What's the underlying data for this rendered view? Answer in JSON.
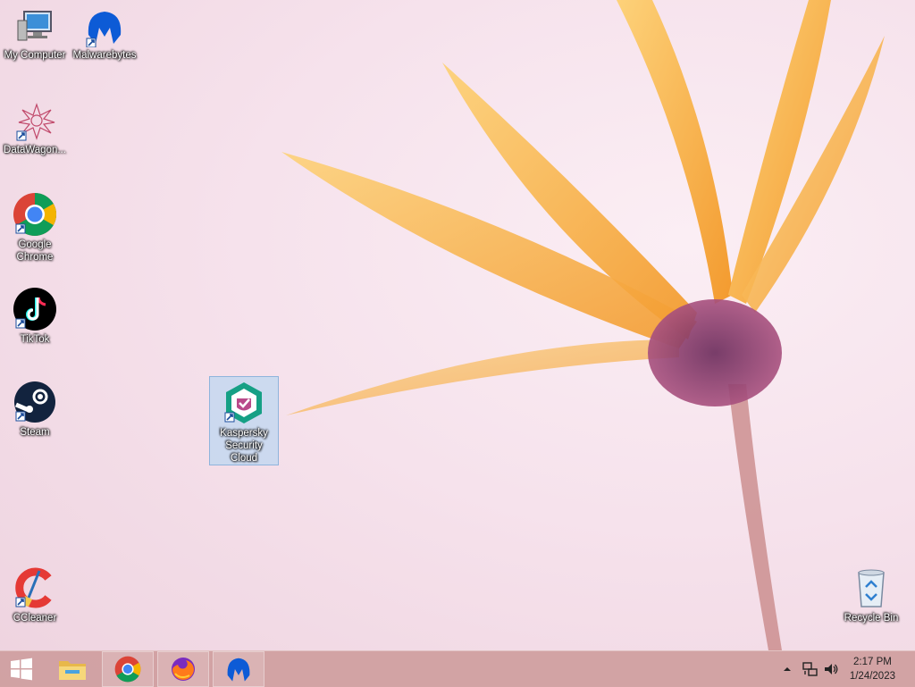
{
  "desktop": {
    "icons": [
      {
        "label": "My Computer",
        "icon": "computer-icon"
      },
      {
        "label": "Malwarebytes",
        "icon": "malwarebytes-icon"
      },
      {
        "label": "DataWagon...",
        "icon": "datawagon-icon"
      },
      {
        "label": "Google Chrome",
        "icon": "chrome-icon"
      },
      {
        "label": "TikTok",
        "icon": "tiktok-icon"
      },
      {
        "label": "Steam",
        "icon": "steam-icon"
      },
      {
        "label": "Kaspersky Security Cloud",
        "icon": "kaspersky-icon",
        "selected": true
      },
      {
        "label": "CCleaner",
        "icon": "ccleaner-icon"
      },
      {
        "label": "Recycle Bin",
        "icon": "recycle-bin-icon"
      }
    ]
  },
  "taskbar": {
    "start_icon": "windows-start-icon",
    "pinned": [
      "file-explorer-icon",
      "chrome-icon",
      "firefox-icon",
      "malwarebytes-icon"
    ],
    "tray": [
      "show-hidden-icons-chevron",
      "network-icon",
      "volume-icon"
    ],
    "clock": {
      "time": "2:17 PM",
      "date": "1/24/2023"
    }
  },
  "colors": {
    "taskbar": "#cd9b9b",
    "selection": "#bed7f0",
    "flower": "#f7b24a"
  }
}
